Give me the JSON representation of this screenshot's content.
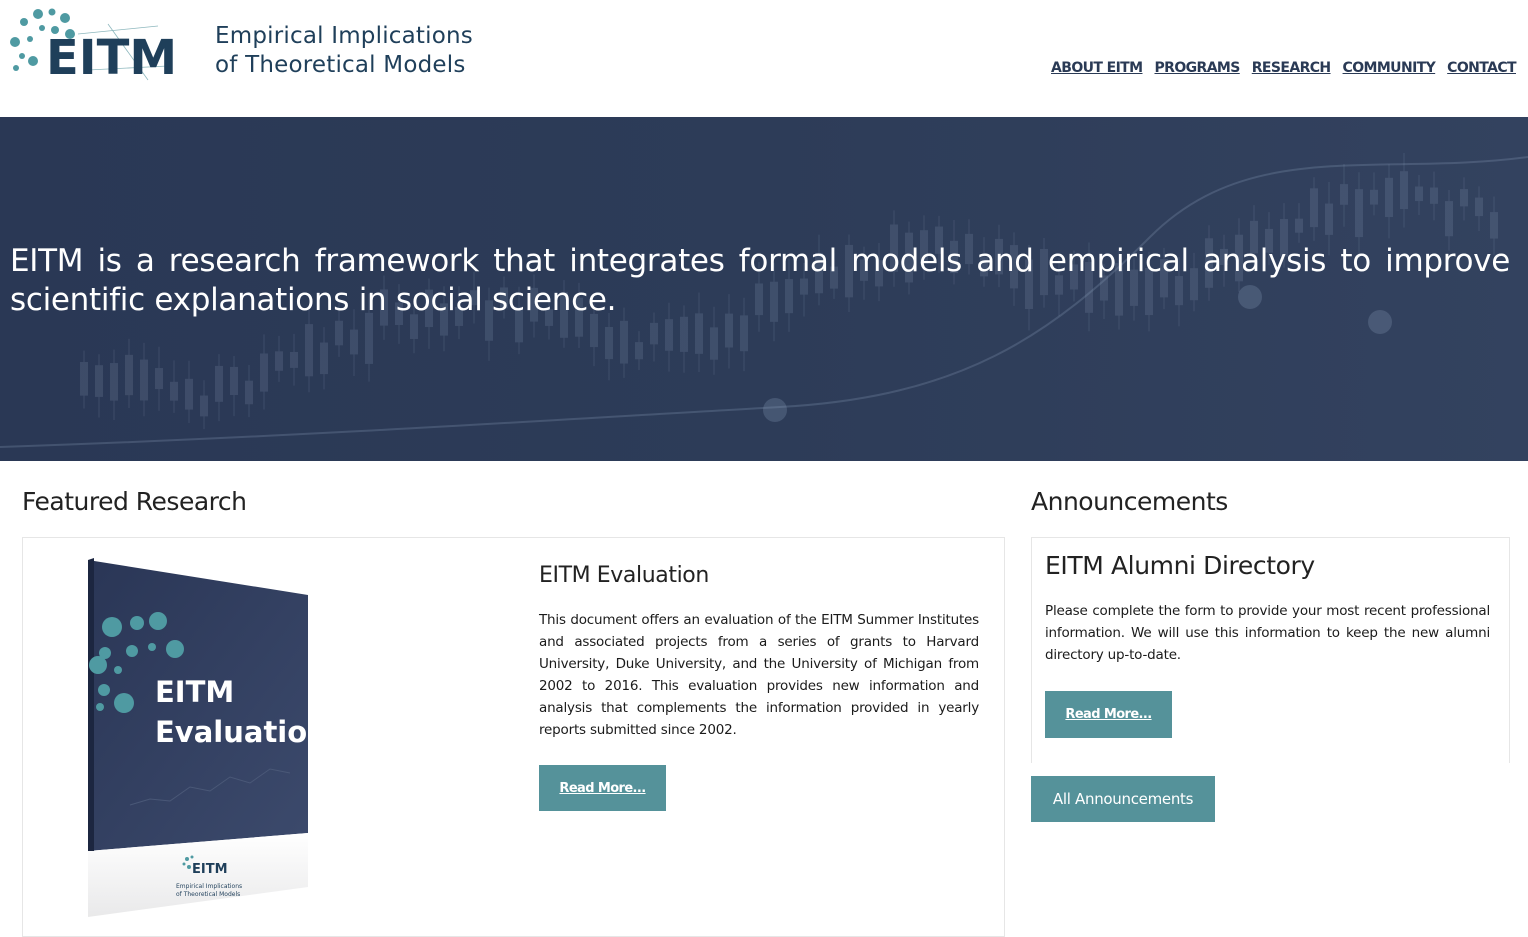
{
  "header": {
    "logo_text": "EITM",
    "title_line1": "Empirical Implications",
    "title_line2": "of Theoretical Models",
    "nav": [
      "ABOUT EITM",
      "PROGRAMS",
      "RESEARCH",
      "COMMUNITY",
      "CONTACT"
    ]
  },
  "hero": {
    "text": "EITM is a research framework that integrates formal models and empirical analysis to improve scientific explanations in social science."
  },
  "featured": {
    "heading": "Featured Research",
    "title": "EITM Evaluation",
    "body": "This document offers an evaluation of the EITM Summer Institutes and associated projects from a series of grants to Harvard University, Duke University, and the University of Michigan from 2002 to 2016. This evaluation provides new information and analysis that complements the information provided in yearly reports submitted since 2002.",
    "button": "Read More...",
    "book": {
      "title_line1": "EITM",
      "title_line2": "Evaluation",
      "small_logo": "EITM",
      "small_line1": "Empirical Implications",
      "small_line2": "of Theoretical Models"
    }
  },
  "announcements": {
    "heading": "Announcements",
    "title": "EITM Alumni Directory",
    "body": "Please complete the form to provide your most recent professional information. We will use this information to keep the new alumni directory up-to-date.",
    "button": "Read More...",
    "all_button": "All Announcements"
  },
  "colors": {
    "brand_navy": "#1f3f5a",
    "brand_teal": "#55929a",
    "hero_bg": "#2d3c58"
  }
}
